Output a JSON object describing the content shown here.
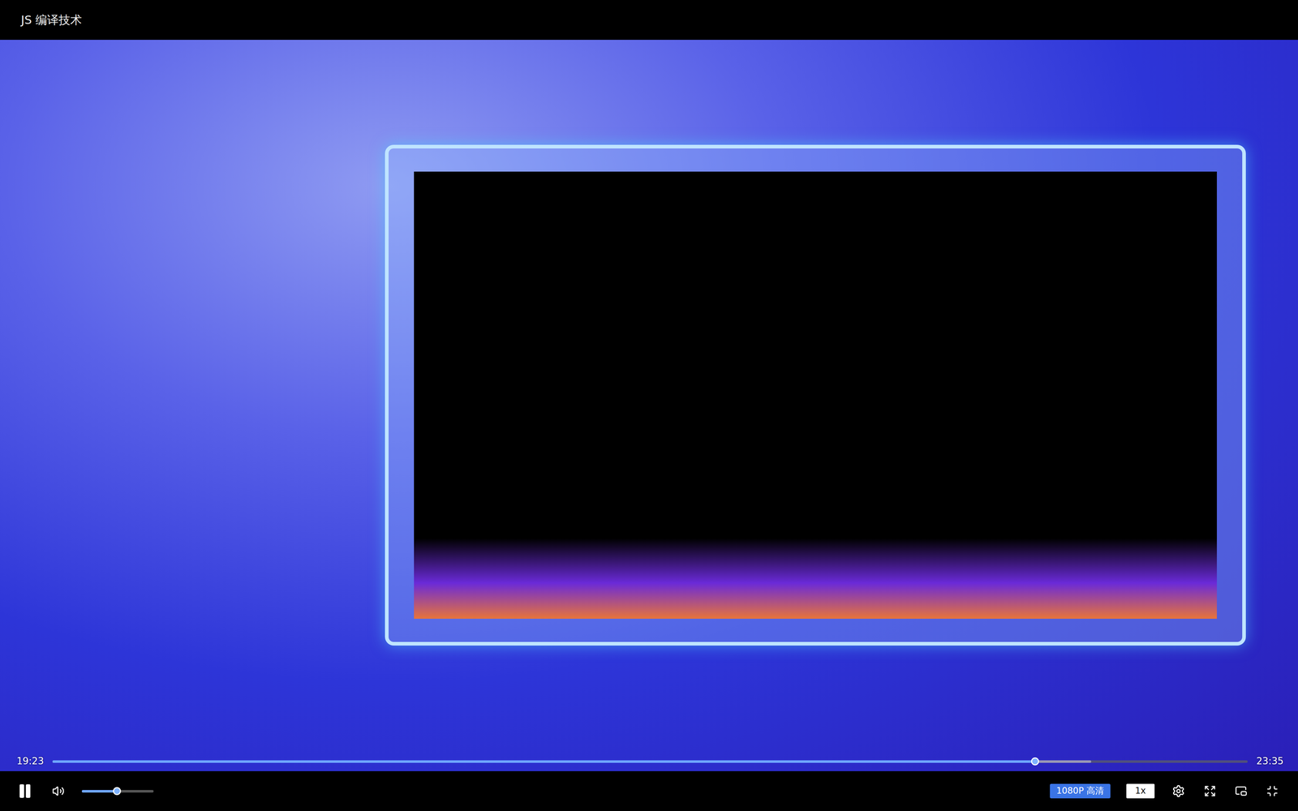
{
  "window": {
    "title": "JS 编译技术"
  },
  "player": {
    "playing": true,
    "muted": false,
    "volume": 0.49,
    "current_time": "19:23",
    "duration": "23:35",
    "progress": {
      "level": 0.822,
      "buffered": 0.869
    },
    "quality": "1080P 高清",
    "speed": "1x",
    "fullscreen": true
  }
}
